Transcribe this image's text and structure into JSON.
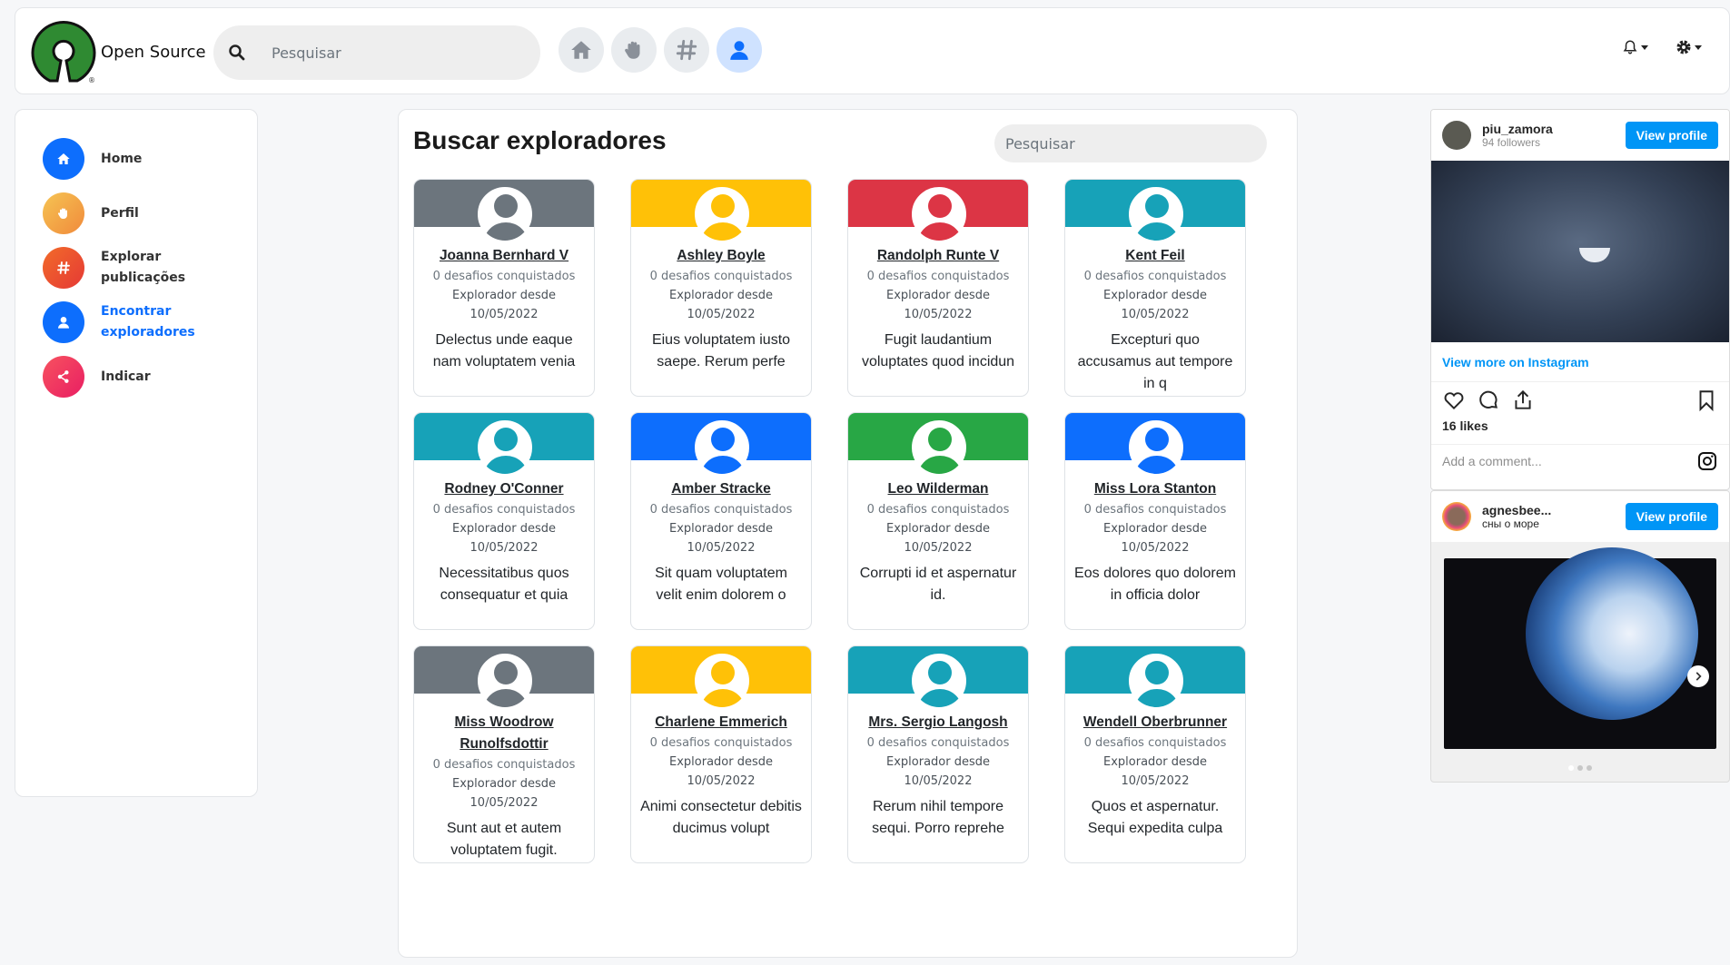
{
  "header": {
    "brand_name": "Open Source",
    "search_placeholder": "Pesquisar",
    "nav": [
      {
        "icon": "home-icon",
        "active": false
      },
      {
        "icon": "hand-icon",
        "active": false
      },
      {
        "icon": "hashtag-icon",
        "active": false
      },
      {
        "icon": "user-icon",
        "active": true
      }
    ]
  },
  "sidebar": {
    "items": [
      {
        "label": "Home",
        "icon": "home-icon",
        "color": "#0d6efd",
        "active": false
      },
      {
        "label": "Perfil",
        "icon": "hand-icon",
        "color": "#f4a340",
        "active": false
      },
      {
        "label": "Explorar publicações",
        "icon": "hashtag-icon",
        "color": "#ea5324",
        "active": false
      },
      {
        "label": "Encontrar exploradores",
        "icon": "user-icon",
        "color": "#0d6efd",
        "active": true
      },
      {
        "label": "Indicar",
        "icon": "share-icon",
        "color": "#f0365d",
        "active": false
      }
    ]
  },
  "main": {
    "title": "Buscar exploradores",
    "search_placeholder": "Pesquisar",
    "meta_challenges": "0 desafios conquistados",
    "meta_since": "Explorador desde",
    "cards": [
      {
        "name": "Joanna Bernhard V",
        "color": "#6c757d",
        "date": "10/05/2022",
        "desc": "Delectus unde eaque nam voluptatem venia"
      },
      {
        "name": "Ashley Boyle",
        "color": "#ffc107",
        "date": "10/05/2022",
        "desc": "Eius voluptatem iusto saepe. Rerum perfe"
      },
      {
        "name": "Randolph Runte V",
        "color": "#dc3545",
        "date": "10/05/2022",
        "desc": "Fugit laudantium voluptates quod incidun"
      },
      {
        "name": "Kent Feil",
        "color": "#17a2b8",
        "date": "10/05/2022",
        "desc": "Excepturi quo accusamus aut tempore in q"
      },
      {
        "name": "Rodney O'Conner",
        "color": "#17a2b8",
        "date": "10/05/2022",
        "desc": "Necessitatibus quos consequatur et quia"
      },
      {
        "name": "Amber Stracke",
        "color": "#0d6efd",
        "date": "10/05/2022",
        "desc": "Sit quam voluptatem velit enim dolorem o"
      },
      {
        "name": "Leo Wilderman",
        "color": "#28a745",
        "date": "10/05/2022",
        "desc": "Corrupti id et aspernatur id."
      },
      {
        "name": "Miss Lora Stanton",
        "color": "#0d6efd",
        "date": "10/05/2022",
        "desc": "Eos dolores quo dolorem in officia dolor"
      },
      {
        "name": "Miss Woodrow Runolfsdottir",
        "color": "#6c757d",
        "date": "10/05/2022",
        "desc": "Sunt aut et autem voluptatem fugit."
      },
      {
        "name": "Charlene Emmerich",
        "color": "#ffc107",
        "date": "10/05/2022",
        "desc": "Animi consectetur debitis ducimus volupt"
      },
      {
        "name": "Mrs. Sergio Langosh",
        "color": "#17a2b8",
        "date": "10/05/2022",
        "desc": "Rerum nihil tempore sequi. Porro reprehe"
      },
      {
        "name": "Wendell Oberbrunner",
        "color": "#17a2b8",
        "date": "10/05/2022",
        "desc": "Quos et aspernatur. Sequi expedita culpa"
      }
    ]
  },
  "instagram": {
    "post1": {
      "username": "piu_zamora",
      "followers": "94 followers",
      "view_profile": "View profile",
      "view_more": "View more on Instagram",
      "likes": "16 likes",
      "comment_placeholder": "Add a comment..."
    },
    "post2": {
      "username": "agnesbee...",
      "subtitle": "сны о море",
      "view_profile": "View profile"
    }
  }
}
